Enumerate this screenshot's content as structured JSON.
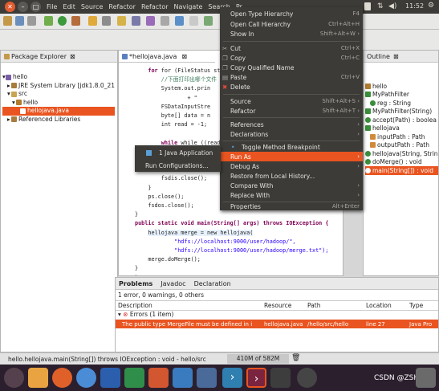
{
  "menubar": {
    "items": [
      "File",
      "Edit",
      "Source",
      "Refactor",
      "Refactor",
      "Navigate",
      "Search",
      "Pr"
    ],
    "time": "11:52"
  },
  "toolbar": {
    "quick_access": "ccess"
  },
  "package_explorer": {
    "title": "Package Explorer",
    "tree": [
      "hello",
      "JRE System Library [jdk1.8.0_21",
      "src",
      "hello",
      "hellojava.java",
      "Referenced Libraries"
    ]
  },
  "editor": {
    "tab": "*hellojava.java",
    "lines": [
      "for (FileStatus sta",
      "//下面打印出哪个文件",
      "System.out.prin",
      "+ \"",
      "FSDataInputStre",
      "byte[] data = n",
      "int read = -1;",
      "",
      "while ((read =",
      "",
      "",
      "",
      "fsdis.close();",
      "}",
      "ps.close();",
      "fsdos.close();",
      "}",
      "public static void main(String[] args) throws IOException {",
      "hellojava merge = new hellojava(",
      "\"hdfs://localhost:9000/user/hadoop/\",",
      "\"hdfs://localhost:9000/user/hadoop/merge.txt\");",
      "merge.doMerge();",
      "}",
      "}"
    ]
  },
  "outline": {
    "title": "Outline",
    "items": [
      "hello",
      "MyPathFilter",
      "reg : String",
      "MyPathFilter(String)",
      "accept(Path) : boolea",
      "hellojava",
      "inputPath : Path",
      "outputPath : Path",
      "hellojava(String, Strin",
      "doMerge() : void",
      "main(String[]) : void"
    ]
  },
  "problems": {
    "tabs": [
      "Problems",
      "Javadoc",
      "Declaration"
    ],
    "summary": "1 error, 0 warnings, 0 others",
    "columns": [
      "Description",
      "Resource",
      "Path",
      "Location",
      "Type"
    ],
    "group": "Errors (1 item)",
    "row": [
      "The public type MergeFile must be defined in i",
      "hellojava.java",
      "/hello/src/hello",
      "line 27",
      "Java Pro"
    ]
  },
  "status": {
    "text": "hello.hellojava.main(String[]) throws IOException : void - hello/src",
    "heap": "410M of 582M"
  },
  "context_menu": {
    "items": [
      {
        "label": "Open Type Hierarchy",
        "sc": "F4"
      },
      {
        "label": "Open Call Hierarchy",
        "sc": "Ctrl+Alt+H"
      },
      {
        "label": "Show In",
        "sc": "Shift+Alt+W ›"
      },
      {
        "label": "Cut",
        "sc": "Ctrl+X"
      },
      {
        "label": "Copy",
        "sc": "Ctrl+C"
      },
      {
        "label": "Copy Qualified Name",
        "sc": ""
      },
      {
        "label": "Paste",
        "sc": "Ctrl+V"
      },
      {
        "label": "Delete",
        "sc": ""
      },
      {
        "label": "Source",
        "sc": "Shift+Alt+S ›"
      },
      {
        "label": "Refactor",
        "sc": "Shift+Alt+T ›"
      },
      {
        "label": "References",
        "sc": "›"
      },
      {
        "label": "Declarations",
        "sc": "›"
      },
      {
        "label": "Toggle Method Breakpoint",
        "sc": ""
      },
      {
        "label": "Run As",
        "sc": "›"
      },
      {
        "label": "Debug As",
        "sc": "›"
      },
      {
        "label": "Restore from Local History...",
        "sc": ""
      },
      {
        "label": "Compare With",
        "sc": "›"
      },
      {
        "label": "Replace With",
        "sc": "›"
      },
      {
        "label": "Properties",
        "sc": "Alt+Enter"
      }
    ]
  },
  "submenu": {
    "items": [
      "1 Java Application",
      "Run Configurations..."
    ]
  },
  "watermark": "CSDN @ZSHJJ"
}
